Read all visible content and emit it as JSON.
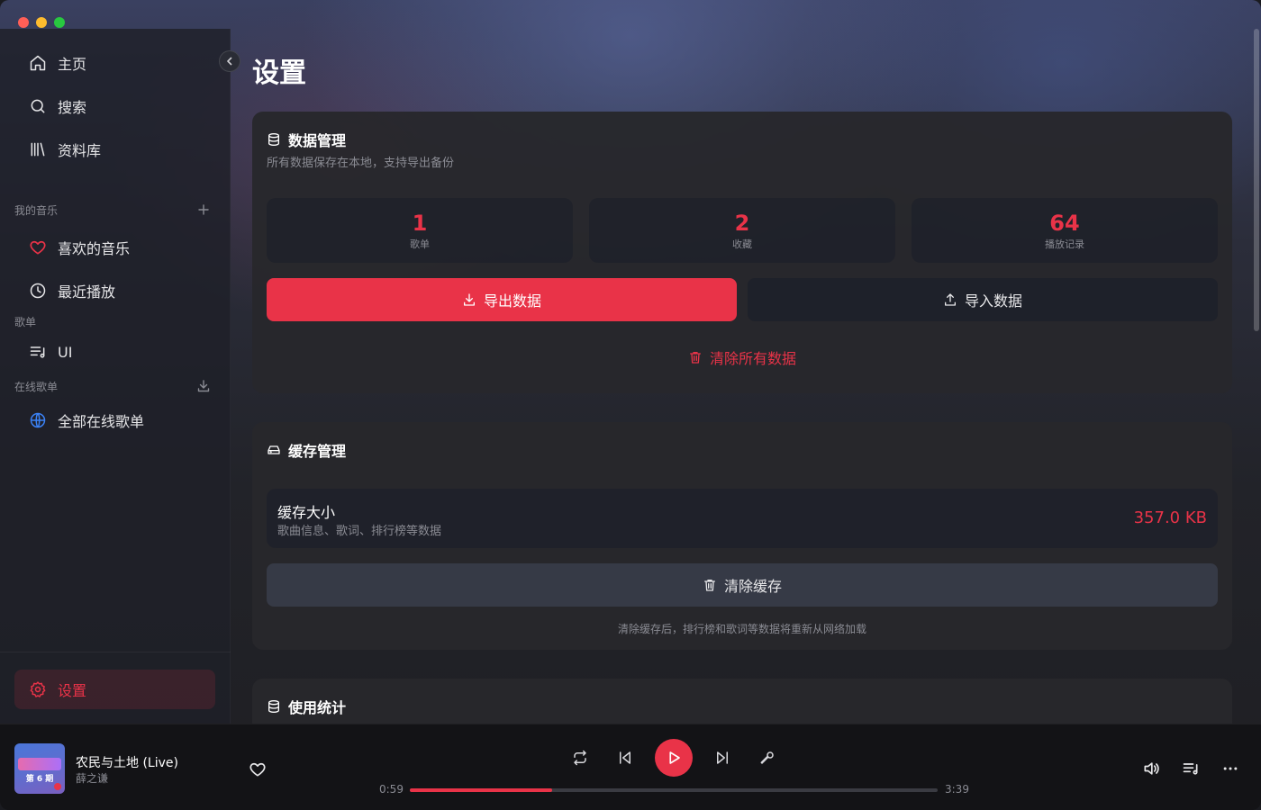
{
  "sidebar": {
    "nav": [
      {
        "label": "主页",
        "icon": "home-icon"
      },
      {
        "label": "搜索",
        "icon": "search-icon"
      },
      {
        "label": "资料库",
        "icon": "library-icon"
      }
    ],
    "my_music_label": "我的音乐",
    "my_music": [
      {
        "label": "喜欢的音乐",
        "icon": "heart-icon"
      },
      {
        "label": "最近播放",
        "icon": "clock-icon"
      }
    ],
    "playlists_label": "歌单",
    "playlists": [
      {
        "label": "UI",
        "icon": "playlist-icon"
      }
    ],
    "online_label": "在线歌单",
    "online": [
      {
        "label": "全部在线歌单",
        "icon": "globe-icon"
      }
    ],
    "settings_label": "设置"
  },
  "page": {
    "title": "设置"
  },
  "data_management": {
    "title": "数据管理",
    "subtitle": "所有数据保存在本地，支持导出备份",
    "stats": [
      {
        "value": "1",
        "label": "歌单"
      },
      {
        "value": "2",
        "label": "收藏"
      },
      {
        "value": "64",
        "label": "播放记录"
      }
    ],
    "export_label": "导出数据",
    "import_label": "导入数据",
    "clear_all_label": "清除所有数据"
  },
  "cache_management": {
    "title": "缓存管理",
    "size_title": "缓存大小",
    "size_desc": "歌曲信息、歌词、排行榜等数据",
    "size_value": "357.0 KB",
    "clear_label": "清除缓存",
    "hint": "清除缓存后，排行榜和歌词等数据将重新从网络加载"
  },
  "usage_stats": {
    "title": "使用统计"
  },
  "player": {
    "cover_text": "第 6 期",
    "song_title": "农民与土地 (Live)",
    "artist": "薛之谦",
    "current_time": "0:59",
    "total_time": "3:39",
    "progress": 0.27
  },
  "colors": {
    "accent": "#e93348",
    "online_icon": "#3b82f6"
  }
}
